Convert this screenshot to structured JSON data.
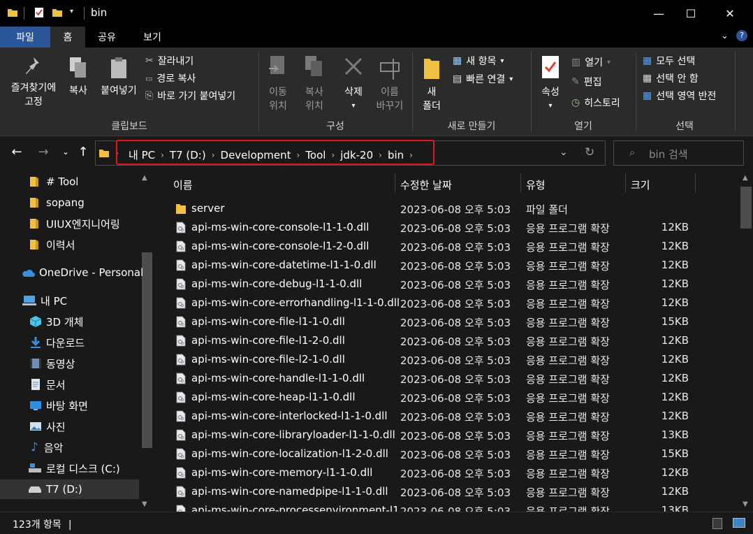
{
  "window": {
    "title": "bin",
    "minimize_glyph": "—",
    "maximize_glyph": "☐",
    "close_glyph": "✕"
  },
  "ribbon_tabs": [
    {
      "label": "파일"
    },
    {
      "label": "홈"
    },
    {
      "label": "공유"
    },
    {
      "label": "보기"
    }
  ],
  "ribbon": {
    "clipboard": {
      "pin_label_1": "즐겨찾기에",
      "pin_label_2": "고정",
      "copy_label": "복사",
      "paste_label": "붙여넣기",
      "cut_label": "잘라내기",
      "copy_path_label": "경로 복사",
      "paste_shortcut_label": "바로 가기 붙여넣기",
      "group_label": "클립보드"
    },
    "organize": {
      "move_label_1": "이동",
      "move_label_2": "위치",
      "copy_to_label_1": "복사",
      "copy_to_label_2": "위치",
      "delete_label": "삭제",
      "rename_label_1": "이름",
      "rename_label_2": "바꾸기",
      "group_label": "구성"
    },
    "new": {
      "new_folder_label_1": "새",
      "new_folder_label_2": "폴더",
      "new_item_label": "새 항목",
      "easy_access_label": "빠른 연결",
      "group_label": "새로 만들기"
    },
    "open": {
      "properties_label": "속성",
      "open_label": "열기",
      "edit_label": "편집",
      "history_label": "히스토리",
      "group_label": "열기"
    },
    "select": {
      "select_all_label": "모두 선택",
      "select_none_label": "선택 안 함",
      "invert_label": "선택 영역 반전",
      "group_label": "선택"
    }
  },
  "address": {
    "breadcrumb": [
      "내 PC",
      "T7 (D:)",
      "Development",
      "Tool",
      "jdk-20",
      "bin"
    ],
    "search_placeholder": "bin 검색"
  },
  "nav_pane": {
    "items": [
      {
        "label": "# Tool",
        "icon": "folder-icon"
      },
      {
        "label": "sopang",
        "icon": "folder-icon"
      },
      {
        "label": "UIUX엔지니어링",
        "icon": "folder-icon"
      },
      {
        "label": "이력서",
        "icon": "folder-icon"
      },
      {
        "label": "OneDrive - Personal",
        "icon": "cloud-icon"
      },
      {
        "label": "내 PC",
        "icon": "computer-icon"
      },
      {
        "label": "3D 개체",
        "icon": "cube-icon"
      },
      {
        "label": "다운로드",
        "icon": "download-icon"
      },
      {
        "label": "동영상",
        "icon": "video-icon"
      },
      {
        "label": "문서",
        "icon": "document-icon"
      },
      {
        "label": "바탕 화면",
        "icon": "desktop-icon"
      },
      {
        "label": "사진",
        "icon": "picture-icon"
      },
      {
        "label": "음악",
        "icon": "music-icon"
      },
      {
        "label": "로컬 디스크 (C:)",
        "icon": "disk-icon"
      },
      {
        "label": "T7 (D:)",
        "icon": "drive-icon"
      }
    ]
  },
  "columns": {
    "name": "이름",
    "modified": "수정한 날짜",
    "type": "유형",
    "size": "크기"
  },
  "files": [
    {
      "name": "server",
      "modified": "2023-06-08 오후 5:03",
      "type": "파일 폴더",
      "size": "",
      "icon": "folder-icon"
    },
    {
      "name": "api-ms-win-core-console-l1-1-0.dll",
      "modified": "2023-06-08 오후 5:03",
      "type": "응용 프로그램 확장",
      "size": "12KB",
      "icon": "dll-icon"
    },
    {
      "name": "api-ms-win-core-console-l1-2-0.dll",
      "modified": "2023-06-08 오후 5:03",
      "type": "응용 프로그램 확장",
      "size": "12KB",
      "icon": "dll-icon"
    },
    {
      "name": "api-ms-win-core-datetime-l1-1-0.dll",
      "modified": "2023-06-08 오후 5:03",
      "type": "응용 프로그램 확장",
      "size": "12KB",
      "icon": "dll-icon"
    },
    {
      "name": "api-ms-win-core-debug-l1-1-0.dll",
      "modified": "2023-06-08 오후 5:03",
      "type": "응용 프로그램 확장",
      "size": "12KB",
      "icon": "dll-icon"
    },
    {
      "name": "api-ms-win-core-errorhandling-l1-1-0.dll",
      "modified": "2023-06-08 오후 5:03",
      "type": "응용 프로그램 확장",
      "size": "12KB",
      "icon": "dll-icon"
    },
    {
      "name": "api-ms-win-core-file-l1-1-0.dll",
      "modified": "2023-06-08 오후 5:03",
      "type": "응용 프로그램 확장",
      "size": "15KB",
      "icon": "dll-icon"
    },
    {
      "name": "api-ms-win-core-file-l1-2-0.dll",
      "modified": "2023-06-08 오후 5:03",
      "type": "응용 프로그램 확장",
      "size": "12KB",
      "icon": "dll-icon"
    },
    {
      "name": "api-ms-win-core-file-l2-1-0.dll",
      "modified": "2023-06-08 오후 5:03",
      "type": "응용 프로그램 확장",
      "size": "12KB",
      "icon": "dll-icon"
    },
    {
      "name": "api-ms-win-core-handle-l1-1-0.dll",
      "modified": "2023-06-08 오후 5:03",
      "type": "응용 프로그램 확장",
      "size": "12KB",
      "icon": "dll-icon"
    },
    {
      "name": "api-ms-win-core-heap-l1-1-0.dll",
      "modified": "2023-06-08 오후 5:03",
      "type": "응용 프로그램 확장",
      "size": "12KB",
      "icon": "dll-icon"
    },
    {
      "name": "api-ms-win-core-interlocked-l1-1-0.dll",
      "modified": "2023-06-08 오후 5:03",
      "type": "응용 프로그램 확장",
      "size": "12KB",
      "icon": "dll-icon"
    },
    {
      "name": "api-ms-win-core-libraryloader-l1-1-0.dll",
      "modified": "2023-06-08 오후 5:03",
      "type": "응용 프로그램 확장",
      "size": "13KB",
      "icon": "dll-icon"
    },
    {
      "name": "api-ms-win-core-localization-l1-2-0.dll",
      "modified": "2023-06-08 오후 5:03",
      "type": "응용 프로그램 확장",
      "size": "15KB",
      "icon": "dll-icon"
    },
    {
      "name": "api-ms-win-core-memory-l1-1-0.dll",
      "modified": "2023-06-08 오후 5:03",
      "type": "응용 프로그램 확장",
      "size": "12KB",
      "icon": "dll-icon"
    },
    {
      "name": "api-ms-win-core-namedpipe-l1-1-0.dll",
      "modified": "2023-06-08 오후 5:03",
      "type": "응용 프로그램 확장",
      "size": "12KB",
      "icon": "dll-icon"
    },
    {
      "name": "api-ms-win-core-processenvironment-l1",
      "modified": "2023-06-08 오후 5:03",
      "type": "응용 프로그램 확장",
      "size": "13KB",
      "icon": "dll-icon"
    }
  ],
  "status": {
    "item_count": "123개 항목"
  },
  "colors": {
    "accent_file_tab": "#2b579a",
    "highlight_border": "#e8131c",
    "folder_yellow": "#f0c040"
  }
}
